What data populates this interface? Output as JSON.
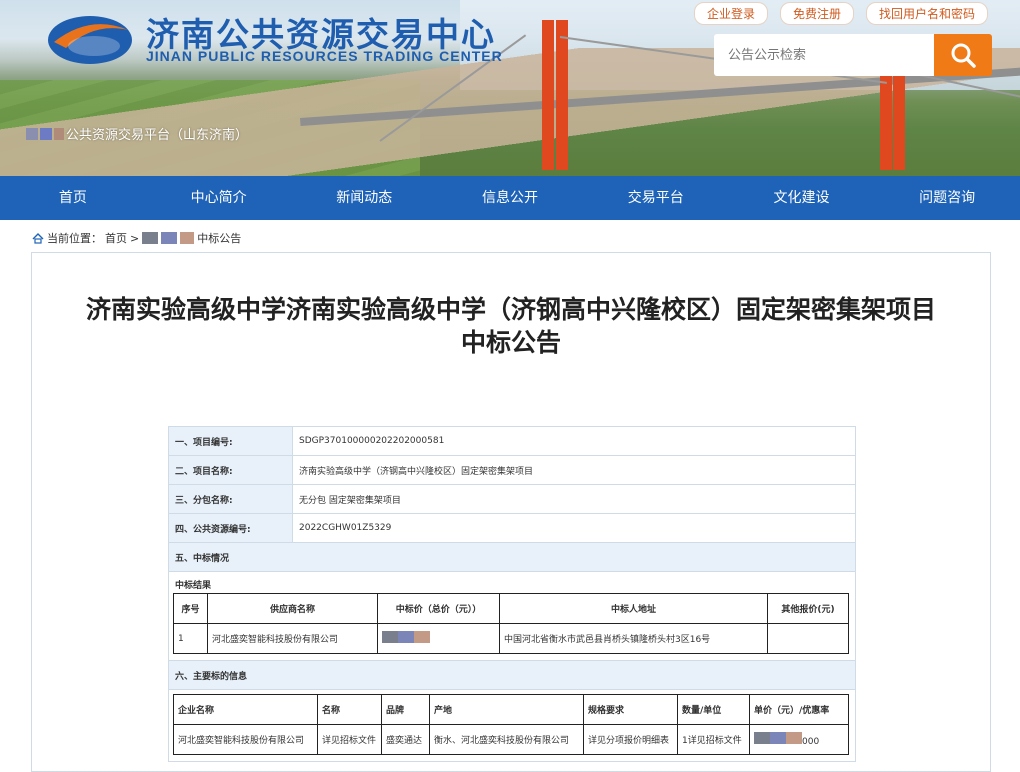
{
  "header": {
    "logo_cn": "济南公共资源交易中心",
    "logo_en": "JINAN PUBLIC RESOURCES TRADING CENTER",
    "platform_label": "公共资源交易平台（山东济南）",
    "top_links": [
      "企业登录",
      "免费注册",
      "找回用户名和密码"
    ],
    "search_placeholder": "公告公示检索"
  },
  "nav": [
    "首页",
    "中心简介",
    "新闻动态",
    "信息公开",
    "交易平台",
    "文化建设",
    "问题咨询"
  ],
  "breadcrumb": {
    "prefix": "当前位置：",
    "home": "首页",
    "separator": ">",
    "current": "中标公告"
  },
  "notice": {
    "title_line1": "济南实验高级中学济南实验高级中学（济钢高中兴隆校区）固定架密集架项目",
    "title_line2": "中标公告",
    "fields": [
      {
        "label": "一、项目编号:",
        "value": "SDGP370100000202202000581"
      },
      {
        "label": "二、项目名称:",
        "value": "济南实验高级中学（济钢高中兴隆校区）固定架密集架项目"
      },
      {
        "label": "三、分包名称:",
        "value": "无分包 固定架密集架项目"
      },
      {
        "label": "四、公共资源编号:",
        "value": "2022CGHW01Z5329"
      }
    ],
    "section5": "五、中标情况",
    "result_title": "中标结果",
    "result_headers": [
      "序号",
      "供应商名称",
      "中标价（总价（元））",
      "中标人地址",
      "其他报价(元)"
    ],
    "result_rows": [
      [
        "1",
        "河北盛奕智能科技股份有限公司",
        "…",
        "中国河北省衡水市武邑县肖桥头镇隆桥头村3区16号",
        ""
      ]
    ],
    "section6": "六、主要标的信息",
    "item_headers": [
      "企业名称",
      "名称",
      "品牌",
      "产地",
      "规格要求",
      "数量/单位",
      "单价（元）/优惠率"
    ],
    "item_rows": [
      [
        "河北盛奕智能科技股份有限公司",
        "详见招标文件",
        "盛奕通达",
        "衡水、河北盛奕科技股份有限公司",
        "详见分项报价明细表",
        "1详见招标文件",
        "000"
      ]
    ]
  },
  "colors": {
    "nav_bg": "#1e63b7",
    "search_button": "#f07a16",
    "label_bg": "#e8f1fa",
    "title_blue": "#1f5eaf"
  }
}
